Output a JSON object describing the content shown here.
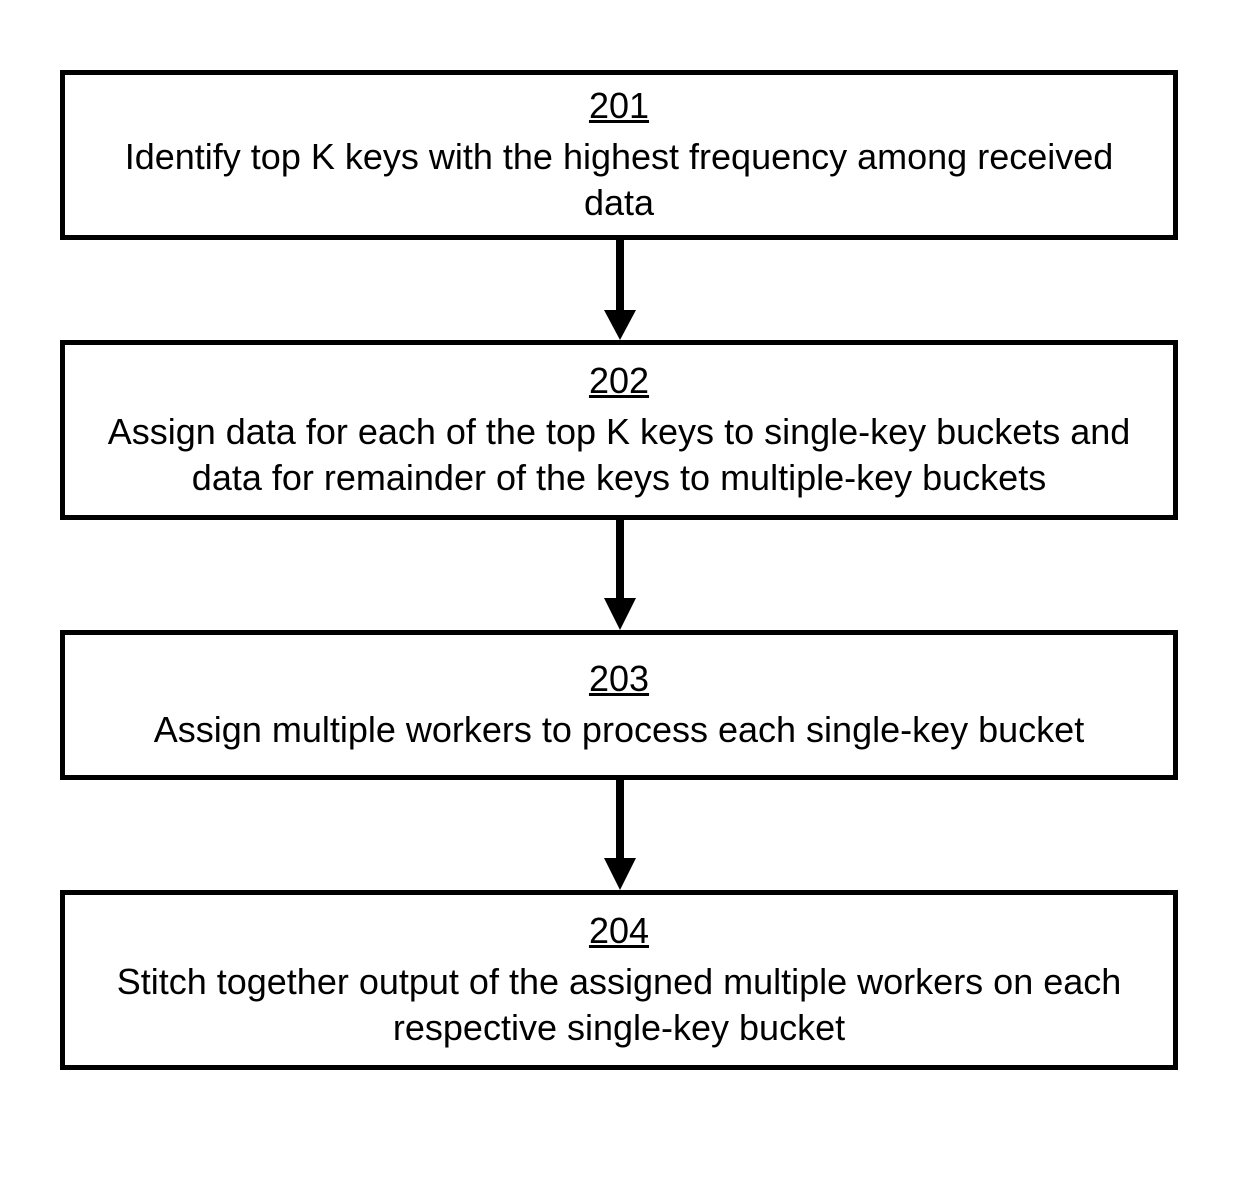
{
  "diagram": {
    "type": "flowchart",
    "direction": "top-to-bottom",
    "steps": [
      {
        "id": "201",
        "text": "Identify top K keys with the highest frequency among received data"
      },
      {
        "id": "202",
        "text": "Assign data for each of the top K keys to single-key buckets and data for remainder of the keys to multiple-key buckets"
      },
      {
        "id": "203",
        "text": "Assign multiple workers to process each single-key bucket"
      },
      {
        "id": "204",
        "text": "Stitch together output of the assigned multiple workers on each respective single-key bucket"
      }
    ]
  }
}
